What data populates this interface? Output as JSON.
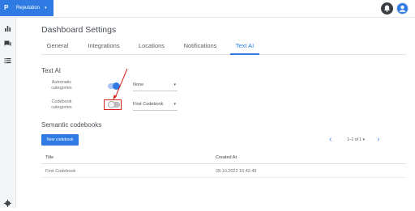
{
  "topbar": {
    "app_name": "Reputation",
    "app_logo": "P",
    "app_caret": "▾",
    "icons": [
      "bell-icon",
      "user-avatar-icon"
    ]
  },
  "sidebar": {
    "icons": [
      "bar-chart-icon",
      "chat-icon",
      "list-icon",
      "gear-icon"
    ]
  },
  "page": {
    "title": "Dashboard Settings"
  },
  "tabs": [
    {
      "label": "General",
      "active": false
    },
    {
      "label": "Integrations",
      "active": false
    },
    {
      "label": "Locations",
      "active": false
    },
    {
      "label": "Notifications",
      "active": false
    },
    {
      "label": "Text AI",
      "active": true
    }
  ],
  "text_ai": {
    "title": "Text AI",
    "automatic": {
      "label_line1": "Automatic",
      "label_line2": "categories",
      "enabled": true,
      "select_value": "None"
    },
    "codebook": {
      "label_line1": "Codebook",
      "label_line2": "categories",
      "enabled": false,
      "select_value": "First Codebook"
    }
  },
  "codebooks": {
    "title": "Semantic codebooks",
    "new_button": "New codebook",
    "pagination": "1–1 of 1 ▾",
    "columns": [
      "Title",
      "Created At"
    ],
    "rows": [
      {
        "title": "First Codebook",
        "created_at": "28.10.2022 16:42:49"
      }
    ]
  },
  "colors": {
    "accent": "#2f7be3",
    "annotation": "#d9231c"
  }
}
